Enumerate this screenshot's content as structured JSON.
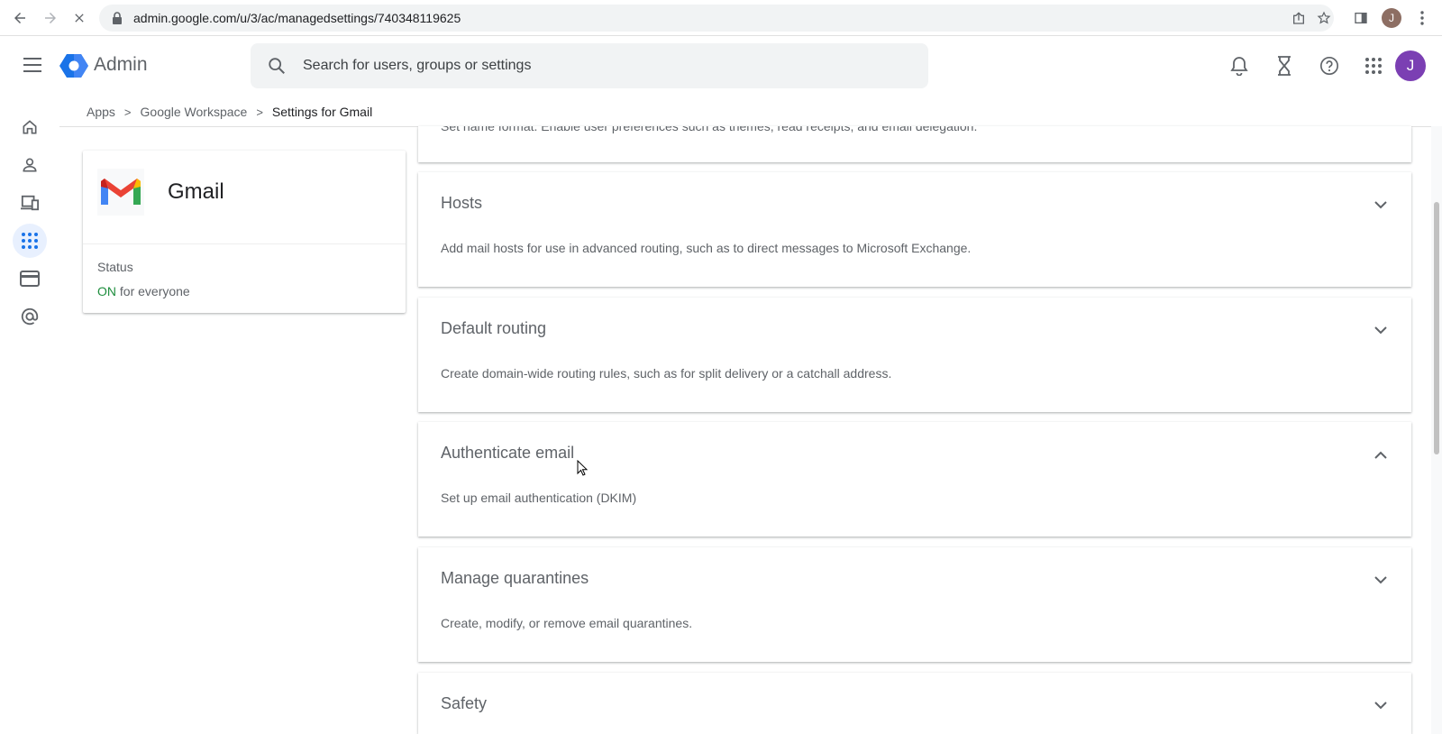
{
  "browser": {
    "url": "admin.google.com/u/3/ac/managedsettings/740348119625",
    "profile_initial": "J"
  },
  "header": {
    "brand": "Admin",
    "search_placeholder": "Search for users, groups or settings",
    "avatar_initial": "J",
    "accent_color": "#1a73e8"
  },
  "breadcrumb": {
    "items": [
      "Apps",
      "Google Workspace",
      "Settings for Gmail"
    ],
    "separator": ">"
  },
  "left_nav": {
    "items": [
      {
        "name": "home-icon"
      },
      {
        "name": "users-icon"
      },
      {
        "name": "devices-icon"
      },
      {
        "name": "apps-icon",
        "active": true
      },
      {
        "name": "billing-icon"
      },
      {
        "name": "domains-icon"
      }
    ]
  },
  "app_card": {
    "name": "Gmail",
    "status_label": "Status",
    "status_on": "ON",
    "status_rest": " for everyone",
    "status_color": "#1e8e3e"
  },
  "partial_panel": {
    "desc": "Set name format. Enable user preferences such as themes, read receipts, and email delegation."
  },
  "panels": [
    {
      "title": "Hosts",
      "desc": "Add mail hosts for use in advanced routing, such as to direct messages to Microsoft Exchange.",
      "expanded": false
    },
    {
      "title": "Default routing",
      "desc": "Create domain-wide routing rules, such as for split delivery or a catchall address.",
      "expanded": false
    },
    {
      "title": "Authenticate email",
      "desc": "Set up email authentication (DKIM)",
      "expanded": true
    },
    {
      "title": "Manage quarantines",
      "desc": "Create, modify, or remove email quarantines.",
      "expanded": false
    },
    {
      "title": "Safety",
      "desc": "",
      "expanded": false
    }
  ]
}
